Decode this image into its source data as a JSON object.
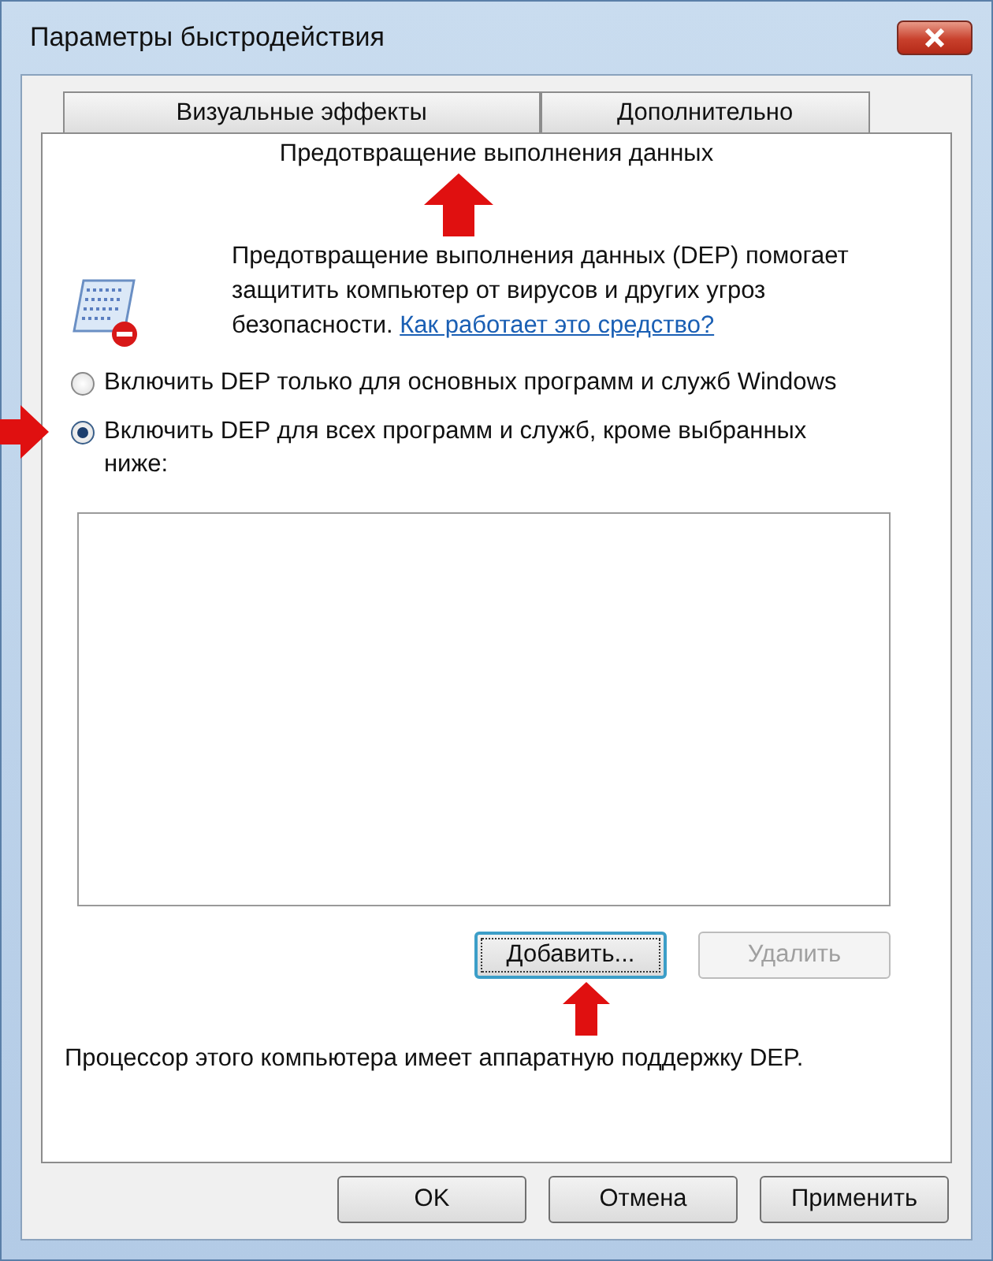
{
  "window": {
    "title": "Параметры быстродействия"
  },
  "tabs": [
    {
      "label": "Визуальные эффекты",
      "selected": false
    },
    {
      "label": "Дополнительно",
      "selected": false
    },
    {
      "label": "Предотвращение выполнения данных",
      "selected": true
    }
  ],
  "description": {
    "text": "Предотвращение выполнения данных (DEP) помогает защитить компьютер от вирусов и других угроз безопасности.",
    "link": "Как работает это средство?"
  },
  "options": [
    {
      "label": "Включить DEP только для основных программ и служб Windows",
      "selected": false
    },
    {
      "label": "Включить DEP для всех программ и служб, кроме выбранных ниже:",
      "selected": true
    }
  ],
  "list_buttons": [
    {
      "label": "Добавить...",
      "disabled": false,
      "focused": true
    },
    {
      "label": "Удалить",
      "disabled": true,
      "focused": false
    }
  ],
  "hardware_note": "Процессор этого компьютера имеет аппаратную поддержку DEP.",
  "buttons": [
    {
      "label": "OK"
    },
    {
      "label": "Отмена"
    },
    {
      "label": "Применить"
    }
  ]
}
